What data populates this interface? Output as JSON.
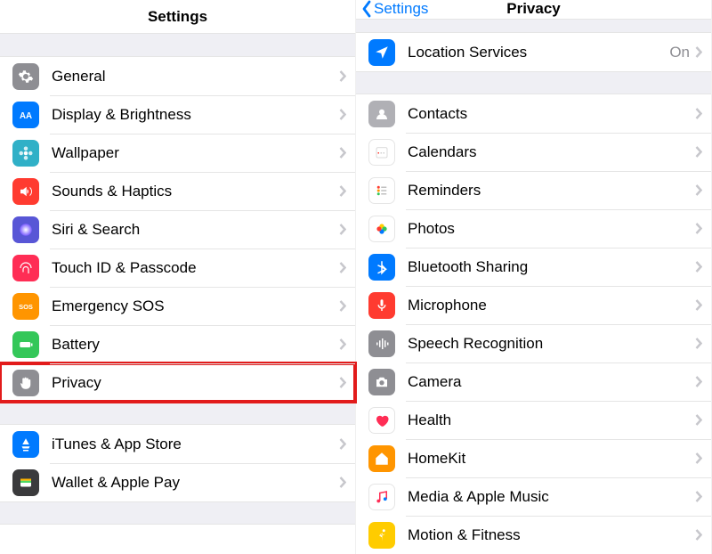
{
  "left": {
    "title": "Settings",
    "groups": [
      [
        {
          "id": "general",
          "label": "General",
          "icon": "gear",
          "bg": "bg-gray"
        },
        {
          "id": "display",
          "label": "Display & Brightness",
          "icon": "aa",
          "bg": "bg-blue"
        },
        {
          "id": "wallpaper",
          "label": "Wallpaper",
          "icon": "flower",
          "bg": "bg-cyan"
        },
        {
          "id": "sounds",
          "label": "Sounds & Haptics",
          "icon": "speaker",
          "bg": "bg-red"
        },
        {
          "id": "siri",
          "label": "Siri & Search",
          "icon": "siri",
          "bg": "bg-purple"
        },
        {
          "id": "touchid",
          "label": "Touch ID & Passcode",
          "icon": "fingerprint",
          "bg": "bg-redpink"
        },
        {
          "id": "sos",
          "label": "Emergency SOS",
          "icon": "sos",
          "bg": "bg-orange"
        },
        {
          "id": "battery",
          "label": "Battery",
          "icon": "battery",
          "bg": "bg-green"
        },
        {
          "id": "privacy",
          "label": "Privacy",
          "icon": "hand",
          "bg": "bg-gray",
          "highlight": true
        }
      ],
      [
        {
          "id": "itunes",
          "label": "iTunes & App Store",
          "icon": "appstore",
          "bg": "bg-blue"
        },
        {
          "id": "wallet",
          "label": "Wallet & Apple Pay",
          "icon": "wallet",
          "bg": "bg-dark"
        }
      ]
    ]
  },
  "right": {
    "back": "Settings",
    "title": "Privacy",
    "groups": [
      [
        {
          "id": "location",
          "label": "Location Services",
          "icon": "location",
          "bg": "bg-blue",
          "value": "On"
        }
      ],
      [
        {
          "id": "contacts",
          "label": "Contacts",
          "icon": "contacts",
          "bg": "bg-gray2"
        },
        {
          "id": "calendars",
          "label": "Calendars",
          "icon": "calendar",
          "bg": "bg-white"
        },
        {
          "id": "reminders",
          "label": "Reminders",
          "icon": "reminders",
          "bg": "bg-white"
        },
        {
          "id": "photos",
          "label": "Photos",
          "icon": "photos",
          "bg": "bg-white"
        },
        {
          "id": "bluetooth",
          "label": "Bluetooth Sharing",
          "icon": "bluetooth",
          "bg": "bg-blue"
        },
        {
          "id": "microphone",
          "label": "Microphone",
          "icon": "mic",
          "bg": "bg-red"
        },
        {
          "id": "speech",
          "label": "Speech Recognition",
          "icon": "wave",
          "bg": "bg-gray"
        },
        {
          "id": "camera",
          "label": "Camera",
          "icon": "camera",
          "bg": "bg-gray"
        },
        {
          "id": "health",
          "label": "Health",
          "icon": "heart",
          "bg": "bg-white"
        },
        {
          "id": "homekit",
          "label": "HomeKit",
          "icon": "home",
          "bg": "bg-orange"
        },
        {
          "id": "media",
          "label": "Media & Apple Music",
          "icon": "music",
          "bg": "bg-white"
        },
        {
          "id": "motion",
          "label": "Motion & Fitness",
          "icon": "motion",
          "bg": "bg-ltorange"
        }
      ]
    ]
  }
}
